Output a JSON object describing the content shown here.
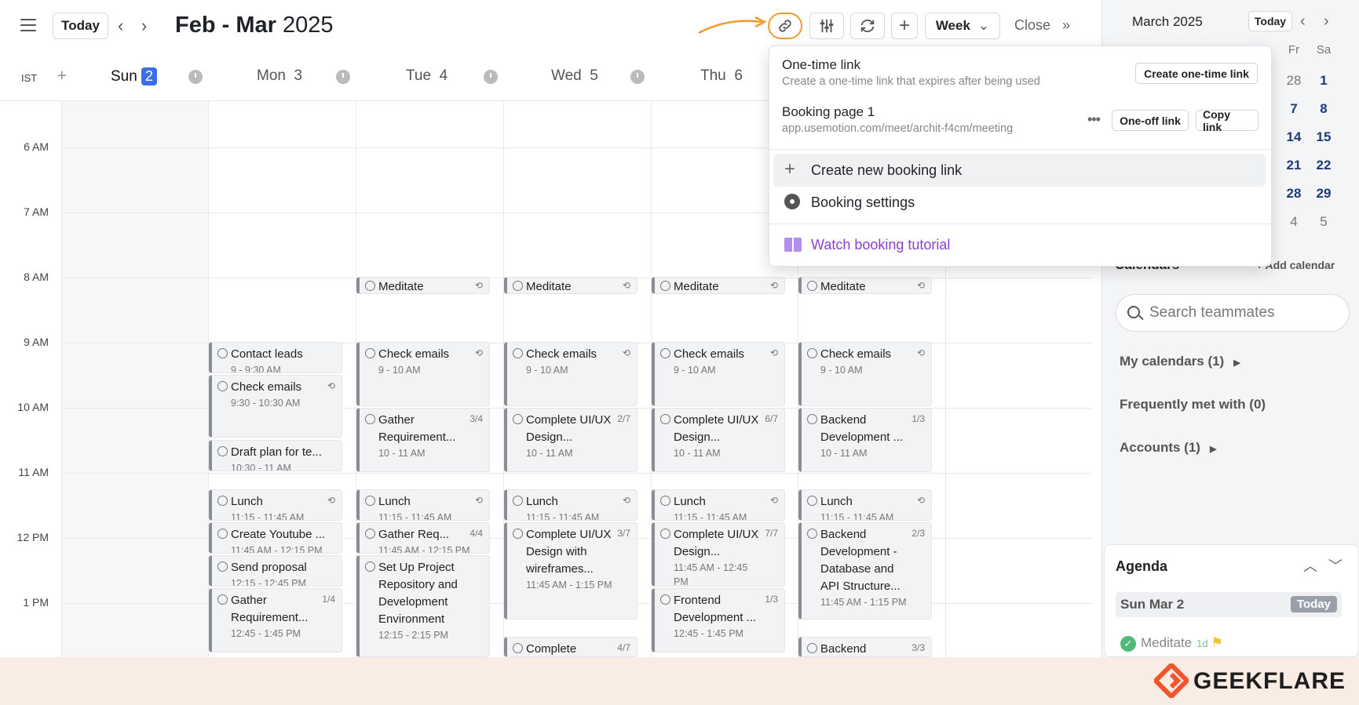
{
  "header": {
    "today": "Today",
    "title_month": "Feb - Mar",
    "title_year": "2025",
    "view": "Week",
    "close": "Close"
  },
  "timezone": {
    "label": "IST",
    "add": "+"
  },
  "days": [
    {
      "name": "Sun",
      "num": "2",
      "today": true
    },
    {
      "name": "Mon",
      "num": "3"
    },
    {
      "name": "Tue",
      "num": "4"
    },
    {
      "name": "Wed",
      "num": "5"
    },
    {
      "name": "Thu",
      "num": "6"
    }
  ],
  "hours": [
    "6 AM",
    "7 AM",
    "8 AM",
    "9 AM",
    "10 AM",
    "11 AM",
    "12 PM",
    "1 PM"
  ],
  "events": {
    "mon": [
      {
        "title": "Contact leads",
        "time": "9 - 9:30 AM",
        "icon": ""
      },
      {
        "title": "Check emails",
        "time": "9:30 - 10:30 AM",
        "icon": "⟲"
      },
      {
        "title": "Draft plan for te...",
        "time": "10:30 - 11 AM",
        "icon": ""
      },
      {
        "title": "Lunch",
        "time": "11:15 - 11:45 AM",
        "icon": "⟲"
      },
      {
        "title": "Create Youtube ...",
        "time": "11:45 AM - 12:15 PM",
        "icon": ""
      },
      {
        "title": "Send proposal",
        "time": "12:15 - 12:45 PM",
        "icon": ""
      },
      {
        "title": "Gather Requirement...",
        "time": "12:45 - 1:45 PM",
        "icon": "1/4"
      }
    ],
    "tue": [
      {
        "title": "Meditate",
        "time": "",
        "icon": "⟲"
      },
      {
        "title": "Check emails",
        "time": "9 - 10 AM",
        "icon": "⟲"
      },
      {
        "title": "Gather Requirement...",
        "time": "10 - 11 AM",
        "icon": "3/4"
      },
      {
        "title": "Lunch",
        "time": "11:15 - 11:45 AM",
        "icon": "⟲"
      },
      {
        "title": "Gather Req...",
        "time": "11:45 AM - 12:15 PM",
        "icon": "4/4"
      },
      {
        "title": "Set Up Project Repository and Development Environment",
        "time": "12:15 - 2:15 PM",
        "icon": ""
      }
    ],
    "wed": [
      {
        "title": "Meditate",
        "time": "",
        "icon": "⟲"
      },
      {
        "title": "Check emails",
        "time": "9 - 10 AM",
        "icon": "⟲"
      },
      {
        "title": "Complete UI/UX Design...",
        "time": "10 - 11 AM",
        "icon": "2/7"
      },
      {
        "title": "Lunch",
        "time": "11:15 - 11:45 AM",
        "icon": "⟲"
      },
      {
        "title": "Complete UI/UX Design with wireframes...",
        "time": "11:45 AM - 1:15 PM",
        "icon": "3/7"
      },
      {
        "title": "Complete",
        "time": "",
        "icon": "4/7"
      }
    ],
    "thu": [
      {
        "title": "Meditate",
        "time": "",
        "icon": "⟲"
      },
      {
        "title": "Check emails",
        "time": "9 - 10 AM",
        "icon": "⟲"
      },
      {
        "title": "Complete UI/UX Design...",
        "time": "10 - 11 AM",
        "icon": "6/7"
      },
      {
        "title": "Lunch",
        "time": "11:15 - 11:45 AM",
        "icon": "⟲"
      },
      {
        "title": "Complete UI/UX Design...",
        "time": "11:45 AM - 12:45 PM",
        "icon": "7/7"
      },
      {
        "title": "Frontend Development ...",
        "time": "12:45 - 1:45 PM",
        "icon": "1/3"
      }
    ],
    "fri": [
      {
        "title": "Meditate",
        "time": "",
        "icon": "⟲"
      },
      {
        "title": "Check emails",
        "time": "9 - 10 AM",
        "icon": "⟲"
      },
      {
        "title": "Backend Development ...",
        "time": "10 - 11 AM",
        "icon": "1/3"
      },
      {
        "title": "Lunch",
        "time": "11:15 - 11:45 AM",
        "icon": "⟲"
      },
      {
        "title": "Backend Development - Database and API Structure...",
        "time": "11:45 AM - 1:15 PM",
        "icon": "2/3"
      },
      {
        "title": "Backend",
        "time": "",
        "icon": "3/3"
      }
    ]
  },
  "popup": {
    "onetime_title": "One-time link",
    "onetime_sub": "Create a one-time link that expires after being used",
    "onetime_btn": "Create one-time link",
    "booking_title": "Booking page 1",
    "booking_url": "app.usemotion.com/meet/archit-f4cm/meeting",
    "oneoff_btn": "One-off link",
    "copy_btn": "Copy link",
    "create_new": "Create new booking link",
    "settings": "Booking settings",
    "tutorial": "Watch booking tutorial"
  },
  "sidebar": {
    "month": "March 2025",
    "today": "Today",
    "mini_head": [
      "Fr",
      "Sa"
    ],
    "mini_rows": [
      [
        "28",
        "1"
      ],
      [
        "7",
        "8"
      ],
      [
        "14",
        "15"
      ],
      [
        "21",
        "22"
      ],
      [
        "28",
        "29"
      ],
      [
        "4",
        "5"
      ]
    ],
    "calendars": "Calendars",
    "add_calendar": "+ Add calendar",
    "search_placeholder": "Search teammates",
    "my_calendars": "My calendars (1)",
    "frequently": "Frequently met with (0)",
    "accounts": "Accounts (1)",
    "agenda": "Agenda",
    "agenda_day": "Sun Mar 2",
    "agenda_today": "Today",
    "agenda_item": "Meditate",
    "agenda_dur": "1d"
  },
  "brand": "GEEKFLARE"
}
